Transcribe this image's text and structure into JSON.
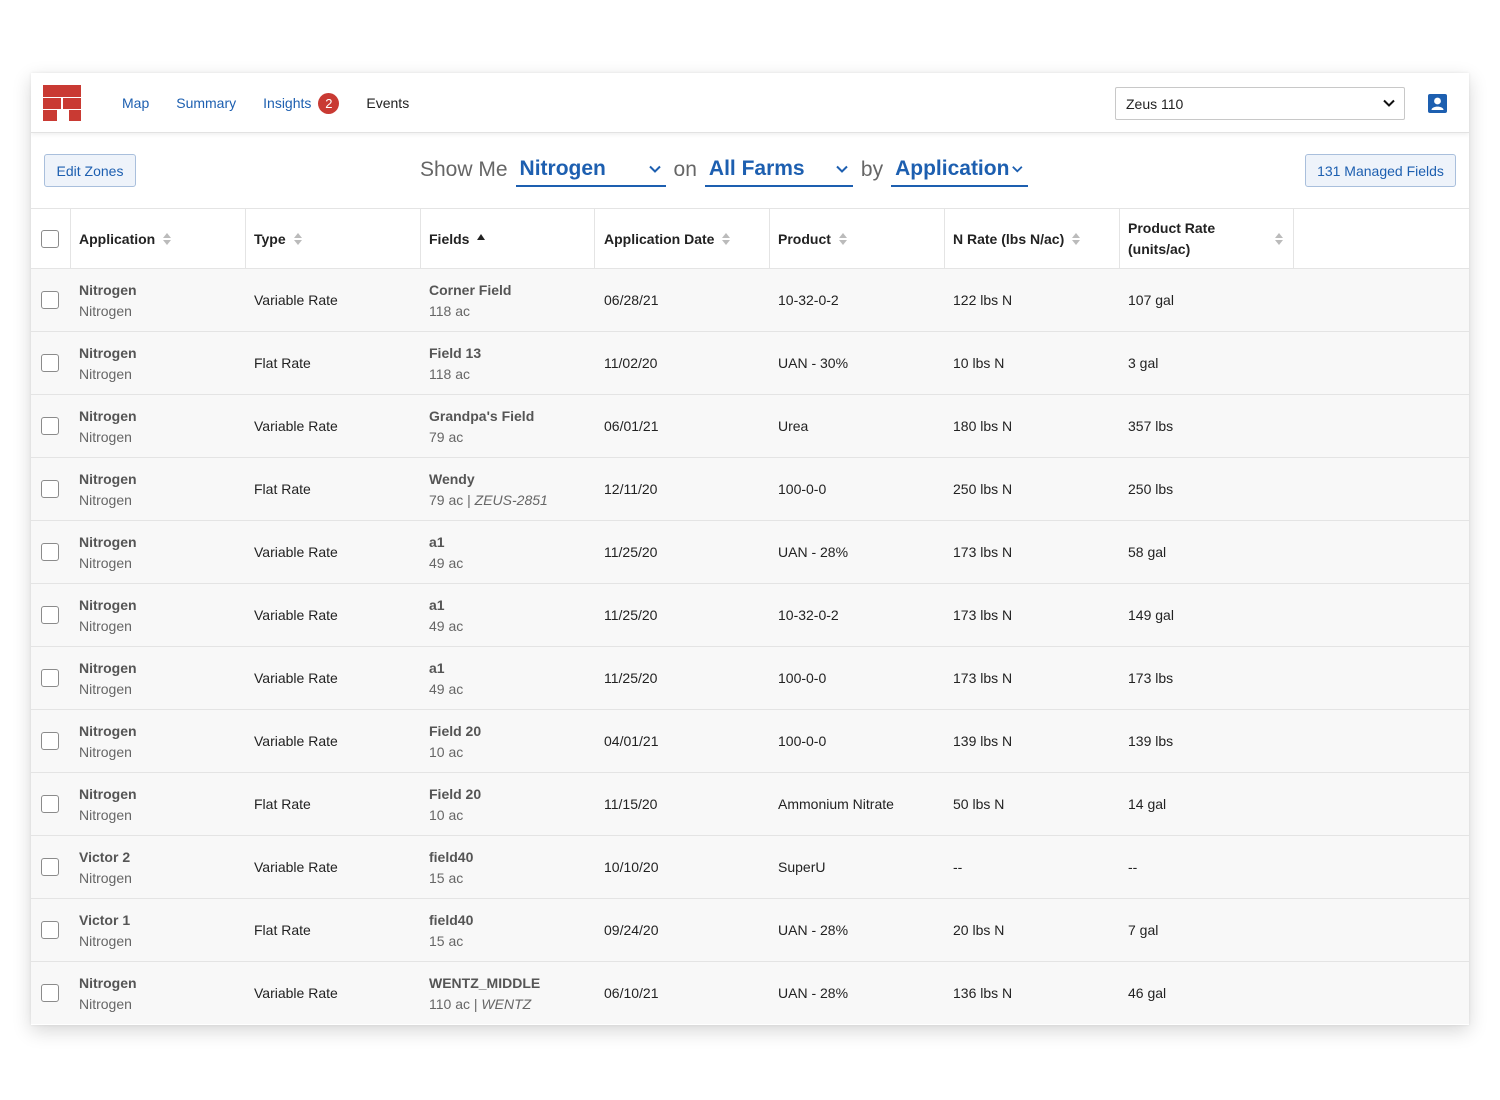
{
  "nav": {
    "links": [
      "Map",
      "Summary",
      "Insights",
      "Events"
    ],
    "insights_badge": "2",
    "org_select": "Zeus 110"
  },
  "toolbar": {
    "edit_zones": "Edit Zones",
    "show_me": "Show Me",
    "nutrient": "Nitrogen",
    "on": "on",
    "farms": "All Farms",
    "by": "by",
    "group": "Application",
    "managed_fields": "131 Managed Fields"
  },
  "table": {
    "headers": {
      "application": "Application",
      "type": "Type",
      "fields": "Fields",
      "date": "Application Date",
      "product": "Product",
      "n_rate": "N Rate (lbs N/ac)",
      "product_rate_1": "Product Rate",
      "product_rate_2": "(units/ac)"
    },
    "rows": [
      {
        "app": "Nitrogen",
        "app_sub": "Nitrogen",
        "type": "Variable Rate",
        "field": "Corner Field",
        "acres": "118 ac",
        "tag": "",
        "date": "06/28/21",
        "product": "10-32-0-2",
        "n_rate": "122 lbs N",
        "product_rate": "107 gal"
      },
      {
        "app": "Nitrogen",
        "app_sub": "Nitrogen",
        "type": "Flat Rate",
        "field": "Field 13",
        "acres": "118 ac",
        "tag": "",
        "date": "11/02/20",
        "product": "UAN - 30%",
        "n_rate": "10 lbs N",
        "product_rate": "3 gal"
      },
      {
        "app": "Nitrogen",
        "app_sub": "Nitrogen",
        "type": "Variable Rate",
        "field": "Grandpa's Field",
        "acres": "79 ac",
        "tag": "",
        "date": "06/01/21",
        "product": "Urea",
        "n_rate": "180 lbs N",
        "product_rate": "357 lbs"
      },
      {
        "app": "Nitrogen",
        "app_sub": "Nitrogen",
        "type": "Flat Rate",
        "field": "Wendy",
        "acres": "79 ac",
        "tag": "ZEUS-2851",
        "date": "12/11/20",
        "product": "100-0-0",
        "n_rate": "250 lbs N",
        "product_rate": "250 lbs"
      },
      {
        "app": "Nitrogen",
        "app_sub": "Nitrogen",
        "type": "Variable Rate",
        "field": "a1",
        "acres": "49 ac",
        "tag": "",
        "date": "11/25/20",
        "product": "UAN - 28%",
        "n_rate": "173 lbs N",
        "product_rate": "58 gal"
      },
      {
        "app": "Nitrogen",
        "app_sub": "Nitrogen",
        "type": "Variable Rate",
        "field": "a1",
        "acres": "49 ac",
        "tag": "",
        "date": "11/25/20",
        "product": "10-32-0-2",
        "n_rate": "173 lbs N",
        "product_rate": "149 gal"
      },
      {
        "app": "Nitrogen",
        "app_sub": "Nitrogen",
        "type": "Variable Rate",
        "field": "a1",
        "acres": "49 ac",
        "tag": "",
        "date": "11/25/20",
        "product": "100-0-0",
        "n_rate": "173 lbs N",
        "product_rate": "173 lbs"
      },
      {
        "app": "Nitrogen",
        "app_sub": "Nitrogen",
        "type": "Variable Rate",
        "field": "Field 20",
        "acres": "10 ac",
        "tag": "",
        "date": "04/01/21",
        "product": "100-0-0",
        "n_rate": "139 lbs N",
        "product_rate": "139 lbs"
      },
      {
        "app": "Nitrogen",
        "app_sub": "Nitrogen",
        "type": "Flat Rate",
        "field": "Field 20",
        "acres": "10 ac",
        "tag": "",
        "date": "11/15/20",
        "product": "Ammonium Nitrate",
        "n_rate": "50 lbs N",
        "product_rate": "14 gal"
      },
      {
        "app": "Victor 2",
        "app_sub": "Nitrogen",
        "type": "Variable Rate",
        "field": "field40",
        "acres": "15 ac",
        "tag": "",
        "date": "10/10/20",
        "product": "SuperU",
        "n_rate": "--",
        "product_rate": "--"
      },
      {
        "app": "Victor 1",
        "app_sub": "Nitrogen",
        "type": "Flat Rate",
        "field": "field40",
        "acres": "15 ac",
        "tag": "",
        "date": "09/24/20",
        "product": "UAN - 28%",
        "n_rate": "20 lbs N",
        "product_rate": "7 gal"
      },
      {
        "app": "Nitrogen",
        "app_sub": "Nitrogen",
        "type": "Variable Rate",
        "field": "WENTZ_MIDDLE",
        "acres": "110 ac",
        "tag": "WENTZ",
        "date": "06/10/21",
        "product": "UAN - 28%",
        "n_rate": "136 lbs N",
        "product_rate": "46 gal"
      }
    ]
  },
  "colors": {
    "brand_red": "#c93a33",
    "link_blue": "#1d5fb0",
    "row_bg": "#f8f8f8"
  }
}
